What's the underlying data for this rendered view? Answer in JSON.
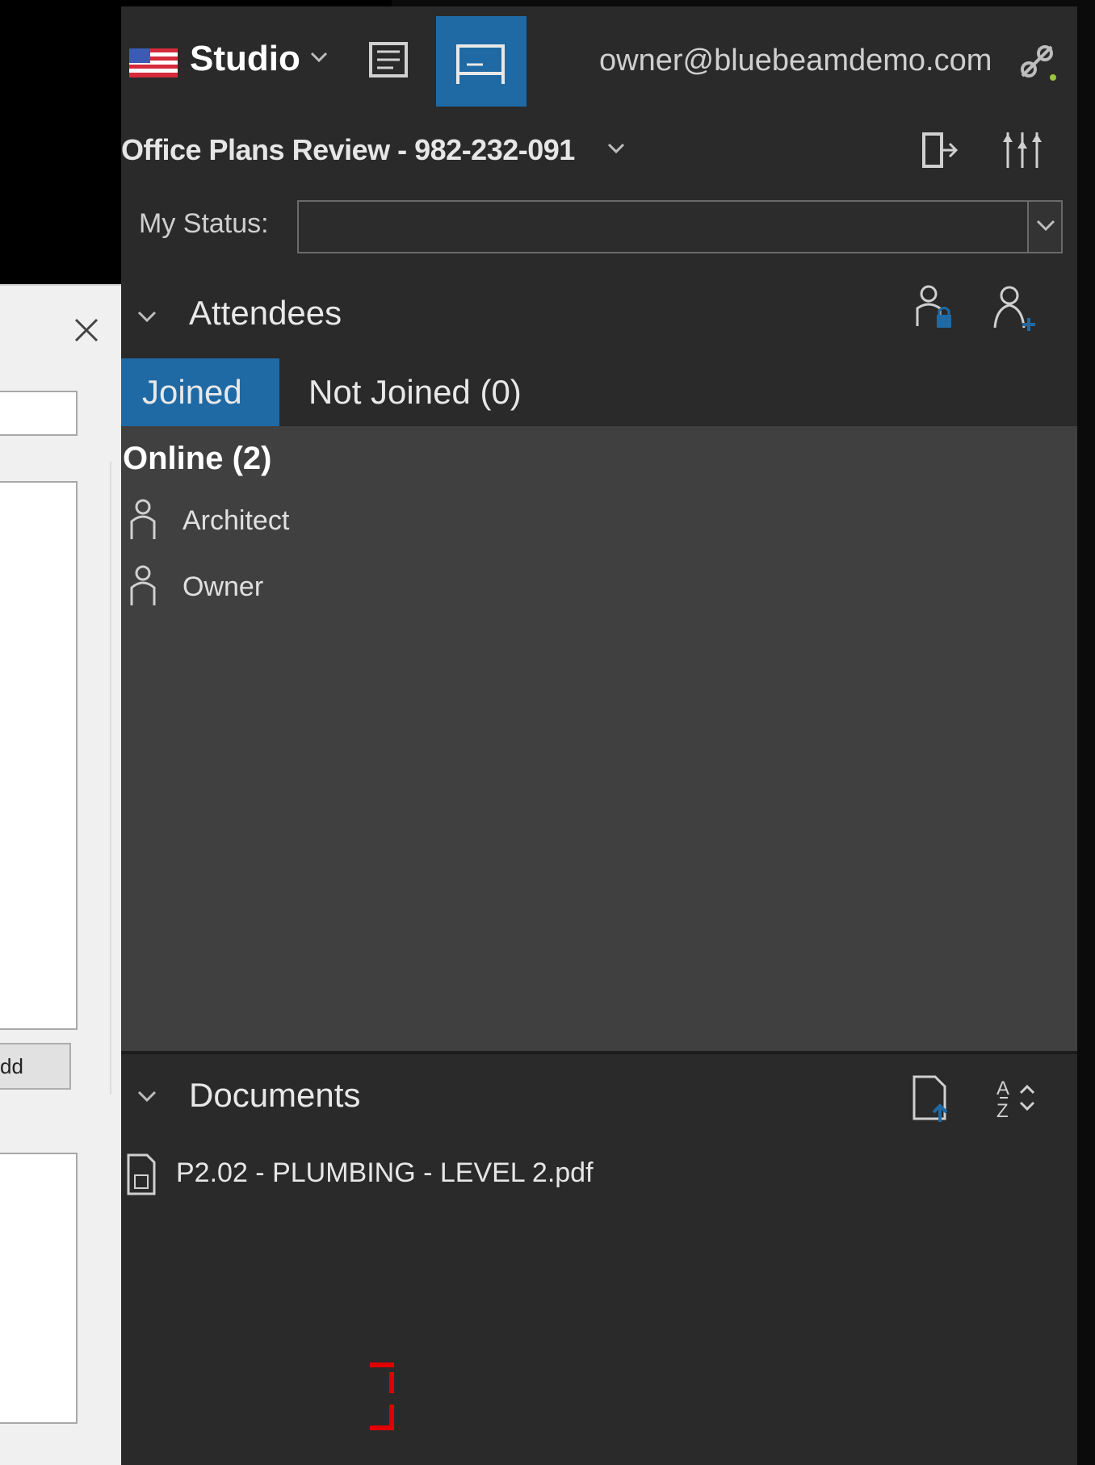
{
  "header": {
    "app_title": "Studio",
    "user_email": "owner@bluebeamdemo.com"
  },
  "session": {
    "title": "Office Plans Review - 982-232-091",
    "status_label": "My Status:",
    "status_value": ""
  },
  "attendees": {
    "title": "Attendees",
    "tabs": [
      {
        "label": "Joined",
        "active": true
      },
      {
        "label": "Not Joined (0)",
        "active": false
      }
    ],
    "online_label": "Online (2)",
    "people": [
      {
        "name": "Architect"
      },
      {
        "name": "Owner"
      }
    ]
  },
  "documents": {
    "title": "Documents",
    "files": [
      {
        "name": "P2.02 - PLUMBING - LEVEL 2.pdf"
      }
    ]
  },
  "dialog": {
    "add_button_label": "dd"
  },
  "colors": {
    "accent": "#1f6aa5",
    "panel": "#2a2a2a",
    "list_bg": "#404040",
    "marker": "#e00000"
  },
  "icons": [
    "markups-list-icon",
    "thumbnails-icon",
    "bookmarks-icon",
    "flag-icon",
    "chevron-down-icon",
    "session-doc-icon",
    "studio-sessions-icon",
    "connection-icon",
    "exit-session-icon",
    "settings-sliders-icon",
    "lock-person-icon",
    "invite-person-icon",
    "person-icon",
    "upload-document-icon",
    "sort-az-icon",
    "pdf-file-icon",
    "close-icon"
  ]
}
